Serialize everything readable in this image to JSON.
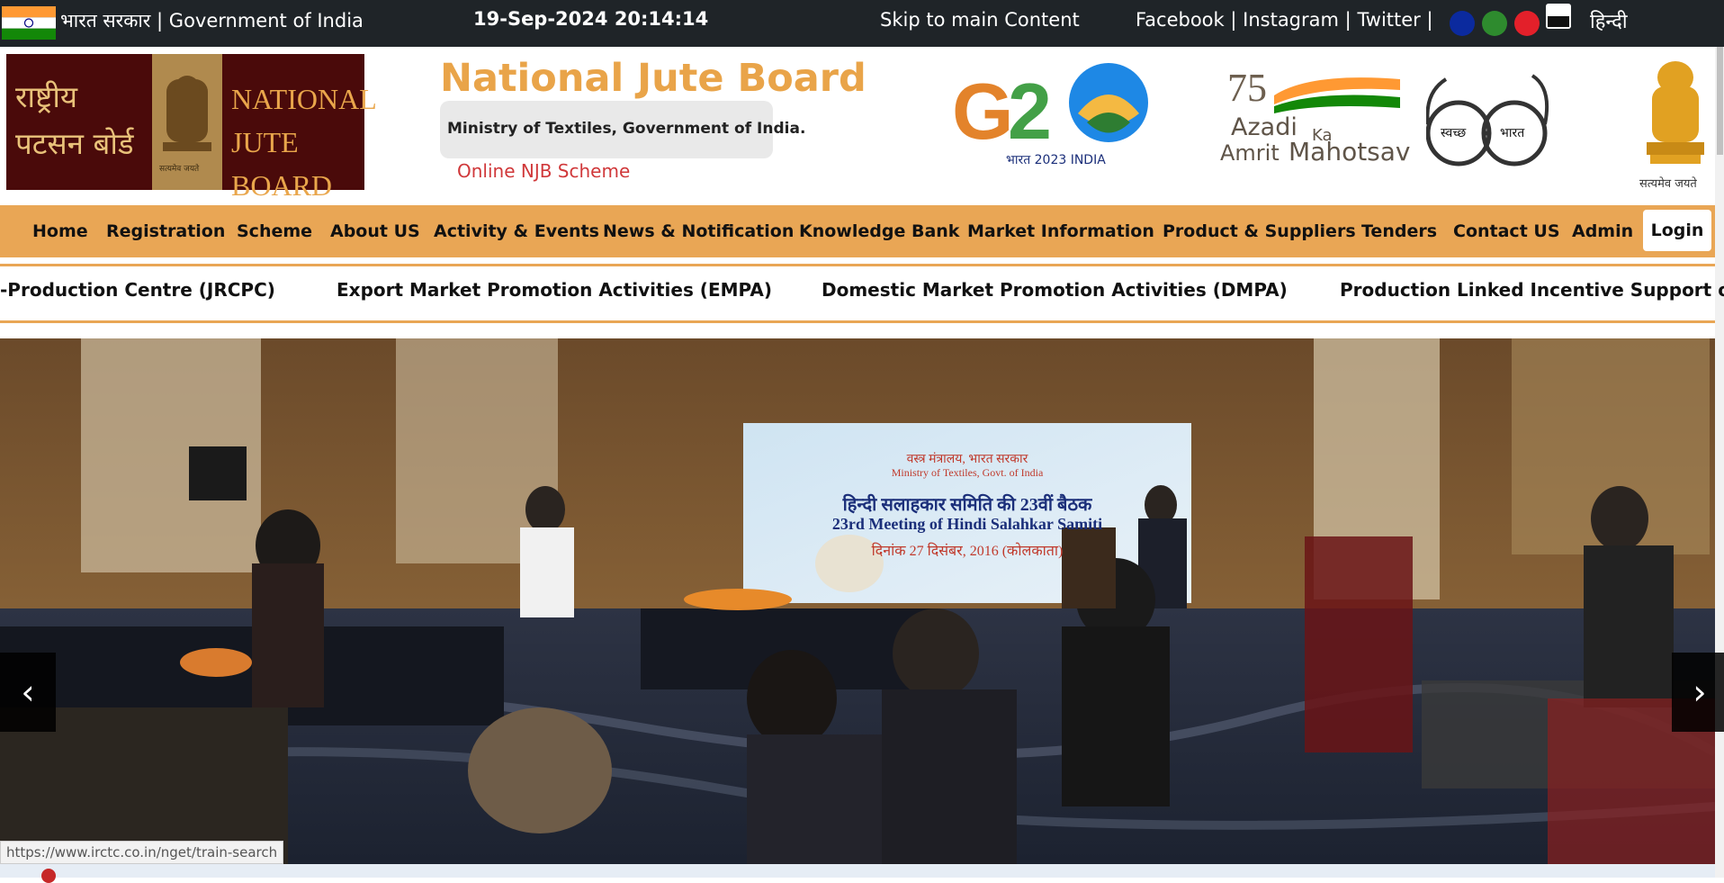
{
  "topbar": {
    "gov_label": "भारत सरकार | Government of India",
    "datetime": "19-Sep-2024 20:14:14",
    "skip": "Skip to main Content",
    "social": [
      "Facebook",
      "Instagram",
      "Twitter"
    ],
    "language": "हिन्दी",
    "theme_colors": [
      "#0b2a9e",
      "#2e8b2e",
      "#e3202a"
    ]
  },
  "header": {
    "logo_hindi": [
      "राष्ट्रीय",
      "पटसन बोर्ड"
    ],
    "logo_english": [
      "NATIONAL",
      "JUTE BOARD"
    ],
    "logo_motto": "सत्यमेव जयते",
    "title": "National Jute Board",
    "ministry": "Ministry of Textiles, Government of India.",
    "online_link": "Online NJB Scheme",
    "g20": {
      "mark": "G20",
      "sub": "भारत 2023 INDIA"
    },
    "azadi": {
      "num": "75",
      "line1": "Azadi",
      "ka": "Ka",
      "amrit": "Amrit",
      "mahotsav": "Mahotsav"
    },
    "swachh": {
      "left": "स्वच्छ",
      "right": "भारत"
    },
    "emblem_motto": "सत्यमेव जयते"
  },
  "nav": {
    "items": [
      "Home",
      "Registration",
      "Scheme",
      "About US",
      "Activity & Events",
      "News & Notification",
      "Knowledge Bank",
      "Market Information",
      "Product & Suppliers",
      "Tenders",
      "Contact US",
      "Admin"
    ],
    "login": "Login"
  },
  "ticker": {
    "items": [
      "-Production Centre (JRCPC)",
      "Export Market Promotion Activities (EMPA)",
      "Domestic Market Promotion Activities (DMPA)",
      "Production Linked Incentive Support on"
    ]
  },
  "slider": {
    "banner": {
      "hindi_line1": "वस्त्र मंत्रालय, भारत सरकार",
      "english_line1": "Ministry of Textiles, Govt. of India",
      "hindi_title": "हिन्दी सलाहकार समिति की 23वीं बैठक",
      "english_title": "23rd Meeting of Hindi Salahkar Samiti",
      "date": "दिनांक 27 दिसंबर, 2016 (कोलकाता)"
    },
    "prev": "‹",
    "next": "›"
  },
  "status_url": "https://www.irctc.co.in/nget/train-search",
  "colors": {
    "accent": "#e9a655",
    "topbar": "#1f2428",
    "link_red": "#d0383a"
  }
}
